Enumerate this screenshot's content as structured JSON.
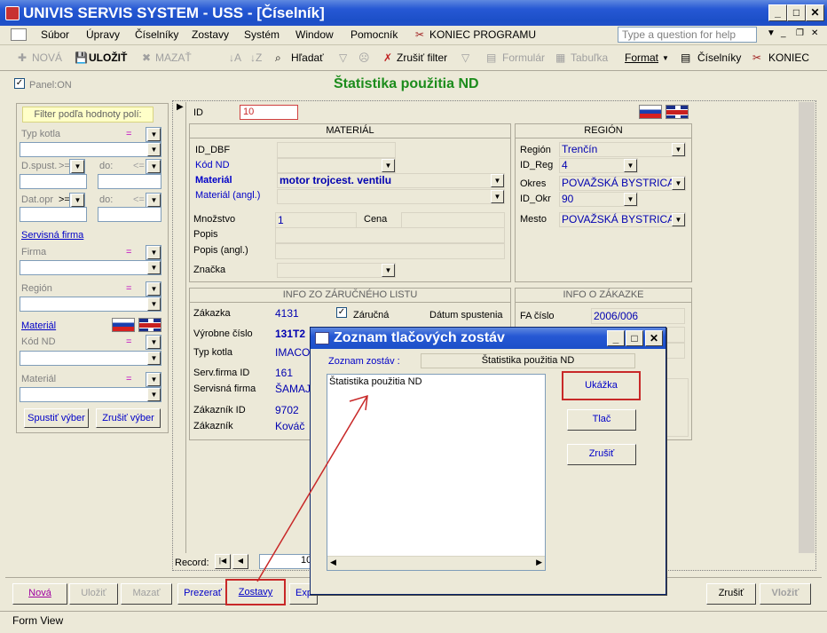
{
  "window": {
    "title": "UNIVIS SERVIS SYSTEM - USS - [Číselník]"
  },
  "menu": {
    "items": [
      "Súbor",
      "Úpravy",
      "Číselníky",
      "Zostavy",
      "Systém",
      "Window",
      "Pomocník"
    ],
    "exit": "KONIEC PROGRAMU",
    "help_placeholder": "Type a question for help"
  },
  "toolbar": {
    "new": "NOVÁ",
    "save": "ULOŽIŤ",
    "delete": "MAZAŤ",
    "find": "Hľadať",
    "clear_filter": "Zrušiť filter",
    "form": "Formulár",
    "table": "Tabuľka",
    "format": "Format",
    "codebooks": "Číselníky",
    "end": "KONIEC"
  },
  "panel": {
    "label": "Panel:ON",
    "checked": true
  },
  "page_title": "Štatistika použitia ND",
  "filter": {
    "header": "Filter podľa hodnoty polí:",
    "typ_kotla": "Typ kotla",
    "eq": "=",
    "dspust": "D.spust.",
    "gte": ">=",
    "do": "do:",
    "lte": "<=",
    "datopr": "Dat.opr",
    "servisna_firma_link": "Servisná firma",
    "firma": "Firma",
    "region": "Región",
    "material_link": "Materiál",
    "kod_nd": "Kód ND",
    "material": "Materiál",
    "run": "Spustiť výber",
    "cancel": "Zrušiť výber"
  },
  "form": {
    "id_label": "ID",
    "id_value": "10",
    "material_hdr": "MATERIÁL",
    "id_dbf": "ID_DBF",
    "kod_nd": "Kód ND",
    "material": "Materiál",
    "material_value": "motor trojcest. ventilu",
    "material_angl": "Materiál (angl.)",
    "mnozstvo": "Množstvo",
    "mnozstvo_value": "1",
    "cena": "Cena",
    "popis": "Popis",
    "popis_angl": "Popis (angl.)",
    "znacka": "Značka",
    "region_hdr": "REGIÓN",
    "region": "Región",
    "region_value": "Trenčín",
    "id_reg": "ID_Reg",
    "id_reg_value": "4",
    "okres": "Okres",
    "okres_value": "POVAŽSKÁ BYSTRICA",
    "id_okr": "ID_Okr",
    "id_okr_value": "90",
    "mesto": "Mesto",
    "mesto_value": "POVAŽSKÁ BYSTRICA",
    "warranty_hdr": "INFO ZO ZÁRUČNÉHO LISTU",
    "zakazka": "Zákazka",
    "zakazka_value": "4131",
    "zarucna": "Záručná",
    "datum_spustenia": "Dátum spustenia",
    "vyrobne_cislo": "Výrobne číslo",
    "vyrobne_cislo_value": "131T2",
    "typ_kotla": "Typ kotla",
    "typ_kotla_value": "IMACO",
    "serv_firma_id": "Serv.firma ID",
    "serv_firma_id_value": "161",
    "servisna_firma": "Servisná firma",
    "servisna_firma_value": "ŠAMAJ",
    "zakaznik_id": "Zákazník ID",
    "zakaznik_id_value": "9702",
    "zakaznik": "Zákazník",
    "zakaznik_value": "Kováč",
    "order_hdr": "INFO O ZÁKAZKE",
    "fa_cislo": "FA číslo",
    "fa_cislo_value": "2006/006",
    "record_label": "Record:",
    "record_value": "10"
  },
  "bottom": {
    "new": "Nová",
    "save": "Uložiť",
    "delete": "Mazať",
    "view": "Prezerať",
    "reports": "Zostavy",
    "export": "Export",
    "cancel": "Zrušiť",
    "insert": "Vložiť"
  },
  "dialog": {
    "title": "Zoznam tlačových zostáv",
    "list_label": "Zoznam zostáv :",
    "list_value": "Štatistika použitia ND",
    "items": [
      "Štatistika použitia ND"
    ],
    "preview": "Ukážka",
    "print": "Tlač",
    "cancel": "Zrušiť"
  },
  "status": "Form View",
  "colors": {
    "title_green": "#1c8c1c",
    "highlight_red": "#c82828",
    "value_blue": "#0000b0"
  }
}
